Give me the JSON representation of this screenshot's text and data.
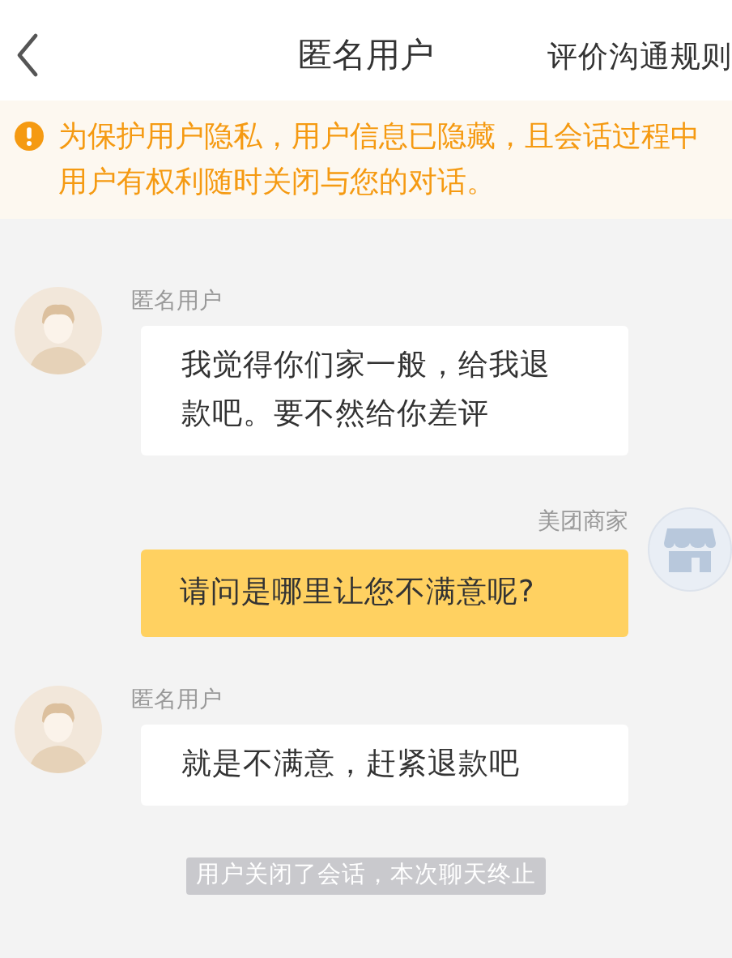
{
  "header": {
    "title": "匿名用户",
    "action": "评价沟通规则"
  },
  "notice": {
    "text": "为保护用户隐私，用户信息已隐藏，且会话过程中用户有权利随时关闭与您的对话。"
  },
  "messages": [
    {
      "kind": "incoming",
      "sender": "匿名用户",
      "text": "我觉得你们家一般，给我退款吧。要不然给你差评"
    },
    {
      "kind": "outgoing",
      "sender": "美团商家",
      "text": "请问是哪里让您不满意呢?"
    },
    {
      "kind": "incoming",
      "sender": "匿名用户",
      "text": "就是不满意，赶紧退款吧"
    },
    {
      "kind": "system",
      "text": "用户关闭了会话，本次聊天终止"
    }
  ]
}
